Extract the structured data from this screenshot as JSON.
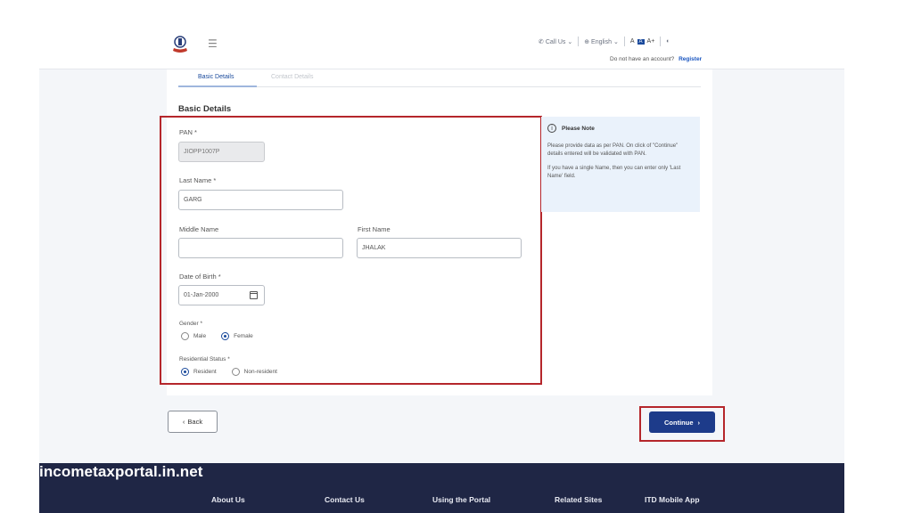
{
  "header": {
    "call_us": "Call Us",
    "language": "English",
    "font_smaller": "A",
    "font_default": "A",
    "font_larger": "A+",
    "account_prompt": "Do not have an account?",
    "register_link": "Register"
  },
  "tabs": [
    {
      "label": "Basic Details"
    },
    {
      "label": "Contact Details"
    }
  ],
  "form": {
    "section_title": "Basic Details",
    "pan": {
      "label": "PAN *",
      "value": "JIOPP1007P"
    },
    "last_name": {
      "label": "Last Name *",
      "value": "GARG"
    },
    "middle_name": {
      "label": "Middle Name",
      "value": ""
    },
    "first_name": {
      "label": "First Name",
      "value": "JHALAK"
    },
    "dob": {
      "label": "Date of Birth *",
      "value": "01-Jan-2000"
    },
    "gender": {
      "label": "Gender *",
      "options": [
        "Male",
        "Female"
      ],
      "selected": "Female"
    },
    "residential_status": {
      "label": "Residential Status *",
      "options": [
        "Resident",
        "Non-resident"
      ],
      "selected": "Resident"
    }
  },
  "note": {
    "title": "Please Note",
    "para1": "Please provide data as per PAN. On click of \"Continue\" details entered will be validated with PAN.",
    "para2": "If you have a single Name, then you can enter only 'Last Name' field."
  },
  "buttons": {
    "back": "Back",
    "continue": "Continue"
  },
  "watermark": "incometaxportal.in.net",
  "footer": {
    "links": [
      "About Us",
      "Contact Us",
      "Using the Portal",
      "Related Sites",
      "ITD Mobile App"
    ]
  },
  "colors": {
    "primary": "#1d3b8a",
    "highlight_border": "#b5262b",
    "footer_bg": "#1f2645",
    "note_bg": "#eaf2fb"
  }
}
